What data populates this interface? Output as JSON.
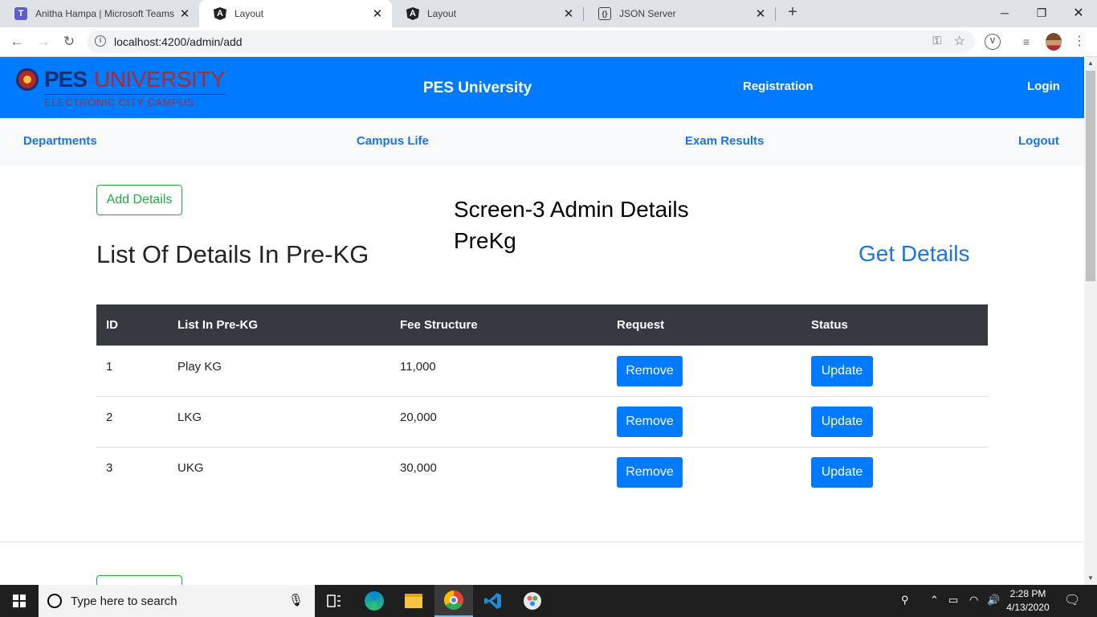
{
  "browser": {
    "tabs": [
      {
        "title": "Anitha Hampa | Microsoft Teams",
        "icon": "teams-icon"
      },
      {
        "title": "Layout",
        "icon": "angular-icon"
      },
      {
        "title": "Layout",
        "icon": "angular-icon"
      },
      {
        "title": "JSON Server",
        "icon": "json-server-icon"
      }
    ],
    "active_tab": 1,
    "url": "localhost:4200/admin/add"
  },
  "topnav": {
    "logo_main": "PES",
    "logo_secondary": "UNIVERSITY",
    "logo_tagline": "ELECTRONIC CITY CAMPUS",
    "brand": "PES University",
    "registration": "Registration",
    "login": "Login"
  },
  "subnav": {
    "departments": "Departments",
    "campus_life": "Campus Life",
    "exam_results": "Exam Results",
    "logout": "Logout"
  },
  "main": {
    "add_details": "Add Details",
    "caption_line1": "Screen-3 Admin Details",
    "caption_line2": "PreKg",
    "heading": "List Of Details In Pre-KG",
    "get_details": "Get Details"
  },
  "table": {
    "headers": [
      "ID",
      "List In Pre-KG",
      "Fee Structure",
      "Request",
      "Status"
    ],
    "rows": [
      {
        "id": "1",
        "name": "Play KG",
        "fee": "11,000",
        "request": "Remove",
        "status": "Update"
      },
      {
        "id": "2",
        "name": "LKG",
        "fee": "20,000",
        "request": "Remove",
        "status": "Update"
      },
      {
        "id": "3",
        "name": "UKG",
        "fee": "30,000",
        "request": "Remove",
        "status": "Update"
      }
    ]
  },
  "taskbar": {
    "search_placeholder": "Type here to search",
    "time": "2:28 PM",
    "date": "4/13/2020"
  },
  "colors": {
    "primary": "#007bff",
    "success": "#28a745",
    "dark": "#343a40"
  }
}
